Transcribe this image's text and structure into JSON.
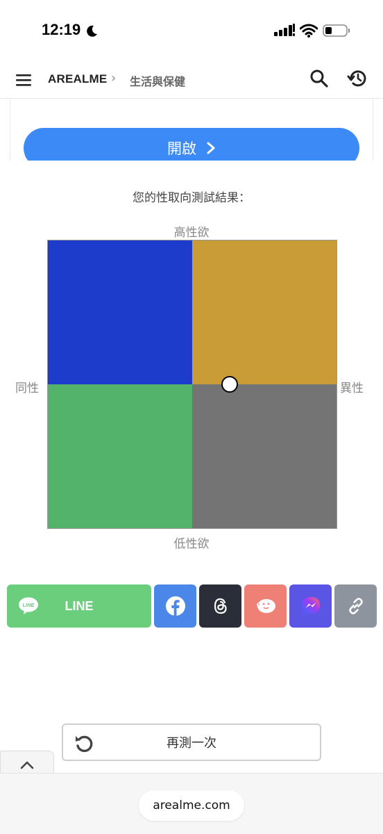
{
  "status_bar": {
    "time": "12:19",
    "icons": [
      "moon-icon",
      "signal-icon",
      "wifi-icon",
      "battery-icon"
    ]
  },
  "nav": {
    "brand": "AREALME",
    "separator": "›",
    "breadcrumb": "生活與保健",
    "icons": [
      "menu-icon",
      "search-icon",
      "history-icon"
    ]
  },
  "open_button": {
    "label": "開啟"
  },
  "result": {
    "title": "您的性取向測試結果：",
    "axis_top": "高性欲",
    "axis_bottom": "低性欲",
    "axis_left": "同性",
    "axis_right": "異性",
    "colors": {
      "top_left": "#1e3ccc",
      "top_right": "#c99c38",
      "bottom_left": "#54b36a",
      "bottom_right": "#747474"
    },
    "marker": {
      "horizontal": 0.63,
      "vertical": 0.5
    }
  },
  "share": {
    "line_label": "LINE",
    "buttons": [
      {
        "name": "facebook",
        "color": "#4b87e8"
      },
      {
        "name": "threads",
        "color": "#2b2e38"
      },
      {
        "name": "plurk",
        "color": "#ef8076"
      },
      {
        "name": "messenger",
        "color": "#5b55e6"
      },
      {
        "name": "copy-link",
        "color": "#8d949e"
      }
    ]
  },
  "retry": {
    "label": "再測一次"
  },
  "bottom": {
    "url": "arealme.com"
  }
}
